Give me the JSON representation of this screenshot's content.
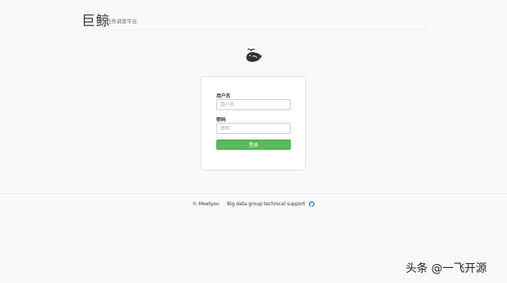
{
  "header": {
    "brand": "巨鲸",
    "tagline": "任务调度平台"
  },
  "logo": {
    "icon": "whale-icon"
  },
  "login_form": {
    "username_label": "用户名",
    "username_placeholder": "用户名",
    "username_value": "",
    "password_label": "密码",
    "password_placeholder": "密码",
    "password_value": "",
    "submit_label": "登录"
  },
  "footer": {
    "copyright": "© Meetyou",
    "support_text": "Big data group technical support",
    "github_icon": "github-icon"
  },
  "watermark": {
    "text": "头条 @一飞开源"
  },
  "colors": {
    "background": "#f8f8f8",
    "primary_button": "#5cb85c",
    "github_blue": "#2b7bb9"
  }
}
